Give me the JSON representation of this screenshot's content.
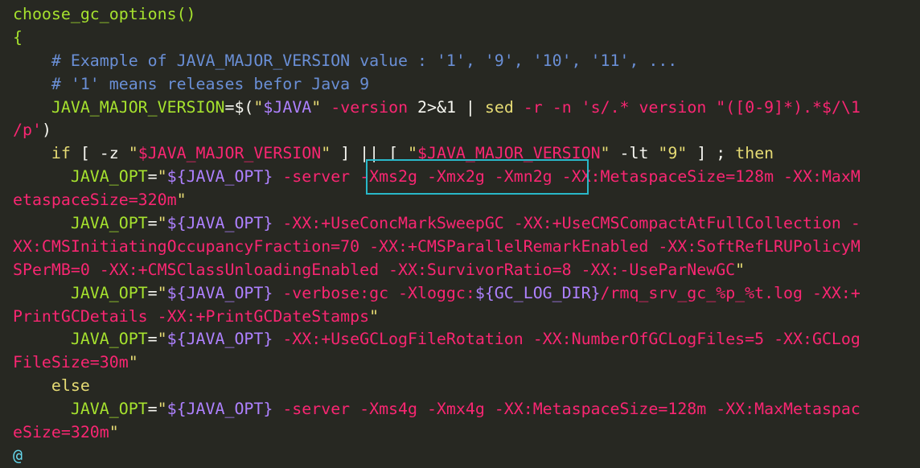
{
  "editor": {
    "lines": [
      [
        {
          "t": "choose_gc_options()",
          "c": "t-fn"
        }
      ],
      [
        {
          "t": "{",
          "c": "t-br"
        }
      ],
      [
        {
          "t": "    # Example of JAVA_MAJOR_VERSION value : '1', '9', '10', '11', ...",
          "c": "t-cm2"
        }
      ],
      [
        {
          "t": "    # '1' means releases befor Java 9",
          "c": "t-cm2"
        }
      ],
      [
        {
          "t": "    JAVA_MAJOR_VERSION",
          "c": "t-var"
        },
        {
          "t": "=$(",
          "c": "t-op"
        },
        {
          "t": "\"",
          "c": "t-str"
        },
        {
          "t": "$JAVA",
          "c": "t-exp"
        },
        {
          "t": "\"",
          "c": "t-str"
        },
        {
          "t": " -version ",
          "c": "t-flag"
        },
        {
          "t": "2>&1",
          "c": "t-plain"
        },
        {
          "t": " | ",
          "c": "t-plain"
        },
        {
          "t": "sed",
          "c": "t-cmd"
        },
        {
          "t": " -r -n ",
          "c": "t-flag"
        },
        {
          "t": "'s/.* version \"([0-9]*).*$/\\1",
          "c": "t-rx"
        }
      ],
      [
        {
          "t": "/p'",
          "c": "t-rx"
        },
        {
          "t": ")",
          "c": "t-op"
        }
      ],
      [
        {
          "t": "    if",
          "c": "t-kw"
        },
        {
          "t": " [ -z ",
          "c": "t-plain"
        },
        {
          "t": "\"",
          "c": "t-str"
        },
        {
          "t": "$JAVA_MAJOR_VERSION",
          "c": "t-flag"
        },
        {
          "t": "\"",
          "c": "t-str"
        },
        {
          "t": " ] || [ ",
          "c": "t-plain"
        },
        {
          "t": "\"",
          "c": "t-str"
        },
        {
          "t": "$JAVA_MAJOR_VERSION",
          "c": "t-flag"
        },
        {
          "t": "\"",
          "c": "t-str"
        },
        {
          "t": " -lt ",
          "c": "t-plain"
        },
        {
          "t": "\"9\"",
          "c": "t-str"
        },
        {
          "t": " ] ; ",
          "c": "t-plain"
        },
        {
          "t": "then",
          "c": "t-kw"
        }
      ],
      [
        {
          "t": "      JAVA_OPT",
          "c": "t-var"
        },
        {
          "t": "=",
          "c": "t-op"
        },
        {
          "t": "\"",
          "c": "t-str"
        },
        {
          "t": "${JAVA_OPT}",
          "c": "t-exp"
        },
        {
          "t": " -server -Xms2g -Xmx2g -Xmn2g -XX:MetaspaceSize=128m -XX:MaxM",
          "c": "t-flag"
        }
      ],
      [
        {
          "t": "etaspaceSize=320m",
          "c": "t-flag"
        },
        {
          "t": "\"",
          "c": "t-str"
        }
      ],
      [
        {
          "t": "      JAVA_OPT",
          "c": "t-var"
        },
        {
          "t": "=",
          "c": "t-op"
        },
        {
          "t": "\"",
          "c": "t-str"
        },
        {
          "t": "${JAVA_OPT}",
          "c": "t-exp"
        },
        {
          "t": " -XX:+UseConcMarkSweepGC -XX:+UseCMSCompactAtFullCollection -",
          "c": "t-flag"
        }
      ],
      [
        {
          "t": "XX:CMSInitiatingOccupancyFraction=70 -XX:+CMSParallelRemarkEnabled -XX:SoftRefLRUPolicyM",
          "c": "t-flag"
        }
      ],
      [
        {
          "t": "SPerMB=0 -XX:+CMSClassUnloadingEnabled -XX:SurvivorRatio=8 -XX:-UseParNewGC",
          "c": "t-flag"
        },
        {
          "t": "\"",
          "c": "t-str"
        }
      ],
      [
        {
          "t": "      JAVA_OPT",
          "c": "t-var"
        },
        {
          "t": "=",
          "c": "t-op"
        },
        {
          "t": "\"",
          "c": "t-str"
        },
        {
          "t": "${JAVA_OPT}",
          "c": "t-exp"
        },
        {
          "t": " -verbose:gc -Xloggc:",
          "c": "t-flag"
        },
        {
          "t": "${GC_LOG_DIR}",
          "c": "t-exp"
        },
        {
          "t": "/rmq_srv_gc_%p_%t.log -XX:+",
          "c": "t-flag"
        }
      ],
      [
        {
          "t": "PrintGCDetails -XX:+PrintGCDateStamps",
          "c": "t-flag"
        },
        {
          "t": "\"",
          "c": "t-str"
        }
      ],
      [
        {
          "t": "      JAVA_OPT",
          "c": "t-var"
        },
        {
          "t": "=",
          "c": "t-op"
        },
        {
          "t": "\"",
          "c": "t-str"
        },
        {
          "t": "${JAVA_OPT}",
          "c": "t-exp"
        },
        {
          "t": " -XX:+UseGCLogFileRotation -XX:NumberOfGCLogFiles=5 -XX:GCLog",
          "c": "t-flag"
        }
      ],
      [
        {
          "t": "FileSize=30m",
          "c": "t-flag"
        },
        {
          "t": "\"",
          "c": "t-str"
        }
      ],
      [
        {
          "t": "    else",
          "c": "t-kw"
        }
      ],
      [
        {
          "t": "      JAVA_OPT",
          "c": "t-var"
        },
        {
          "t": "=",
          "c": "t-op"
        },
        {
          "t": "\"",
          "c": "t-str"
        },
        {
          "t": "${JAVA_OPT}",
          "c": "t-exp"
        },
        {
          "t": " -server -Xms4g -Xmx4g -XX:MetaspaceSize=128m -XX:MaxMetaspac",
          "c": "t-flag"
        }
      ],
      [
        {
          "t": "eSize=320m",
          "c": "t-flag"
        },
        {
          "t": "\"",
          "c": "t-str"
        }
      ],
      [
        {
          "t": "@",
          "c": "t-at"
        }
      ]
    ]
  },
  "colors": {
    "background": "#272822",
    "highlight_border": "#29b8c9"
  }
}
